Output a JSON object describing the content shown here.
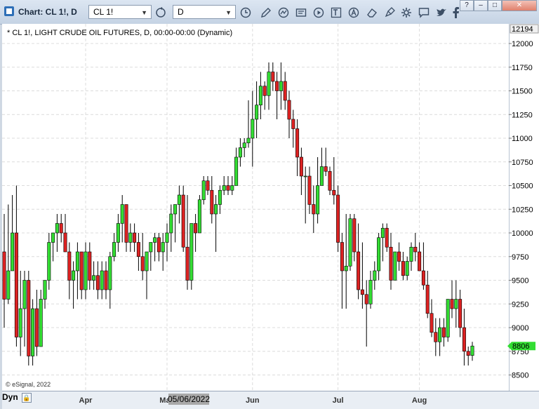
{
  "window": {
    "title": "Chart: CL 1!, D",
    "symbol_combo": "CL 1!",
    "interval_combo": "D",
    "controls": [
      "?",
      "–",
      "□",
      "✕"
    ]
  },
  "toolbar": {
    "icons": [
      "refresh-icon",
      "clock-icon",
      "pencil-icon",
      "line-tool-icon",
      "data-window-icon",
      "play-icon",
      "text-tool-icon",
      "annotation-icon",
      "eraser-icon",
      "settings-icon",
      "chat-icon",
      "twitter-icon",
      "facebook-icon"
    ]
  },
  "chart_header": "* CL 1!, LIGHT CRUDE OIL FUTURES, D, 00:00-00:00 (Dynamic)",
  "copyright": "© eSignal, 2022",
  "status": {
    "mode_label": "Dyn",
    "lock_icon": "lock-icon"
  },
  "price_axis": {
    "top_label": "12194",
    "last_price_label": "8806",
    "last_price_color": "#33dd33"
  },
  "date_axis": {
    "cursor_date": "05/06/2022"
  },
  "colors": {
    "up": "#33dd33",
    "down": "#dd2222",
    "grid": "#dcdcdc"
  },
  "chart_data": {
    "type": "candlestick",
    "ylim": [
      8400,
      12200
    ],
    "y_ticks": [
      8500,
      8750,
      9000,
      9250,
      9500,
      9750,
      10000,
      10250,
      10500,
      10750,
      11000,
      11250,
      11500,
      11750,
      12000
    ],
    "x_labels": [
      {
        "label": "Apr",
        "index": 20
      },
      {
        "label": "May",
        "index": 40
      },
      {
        "label": "Jun",
        "index": 61
      },
      {
        "label": "Jul",
        "index": 82
      },
      {
        "label": "Aug",
        "index": 102
      }
    ],
    "candles": [
      [
        9800,
        10200,
        9000,
        9300
      ],
      [
        9300,
        10300,
        9250,
        9600
      ],
      [
        9600,
        10400,
        9600,
        10000
      ],
      [
        10000,
        10500,
        8800,
        8900
      ],
      [
        8900,
        9600,
        8700,
        9200
      ],
      [
        9200,
        9600,
        8800,
        9500
      ],
      [
        9500,
        9600,
        8600,
        8700
      ],
      [
        8700,
        9300,
        8600,
        9200
      ],
      [
        9200,
        9400,
        8700,
        8800
      ],
      [
        8800,
        9400,
        8800,
        9300
      ],
      [
        9300,
        9500,
        9200,
        9500
      ],
      [
        9500,
        10000,
        9400,
        9900
      ],
      [
        9900,
        10000,
        9700,
        10000
      ],
      [
        10000,
        10200,
        9800,
        10100
      ],
      [
        10100,
        10200,
        9900,
        10000
      ],
      [
        10000,
        10200,
        9900,
        9800
      ],
      [
        9800,
        9900,
        9300,
        9500
      ],
      [
        9500,
        9700,
        9200,
        9600
      ],
      [
        9600,
        9900,
        9300,
        9800
      ],
      [
        9800,
        9800,
        9300,
        9400
      ],
      [
        9400,
        9900,
        9300,
        9800
      ],
      [
        9800,
        9900,
        9400,
        9500
      ],
      [
        9500,
        9700,
        9400,
        9550
      ],
      [
        9550,
        9700,
        9300,
        9400
      ],
      [
        9400,
        9700,
        9300,
        9600
      ],
      [
        9600,
        9700,
        9300,
        9400
      ],
      [
        9400,
        9800,
        9200,
        9750
      ],
      [
        9750,
        10000,
        9700,
        9900
      ],
      [
        9900,
        10200,
        9800,
        10100
      ],
      [
        10100,
        10400,
        9900,
        10300
      ],
      [
        10300,
        10300,
        9800,
        9900
      ],
      [
        9900,
        10100,
        9800,
        10000
      ],
      [
        10000,
        10100,
        9800,
        9900
      ],
      [
        9900,
        10000,
        9600,
        9750
      ],
      [
        9750,
        10000,
        9500,
        9600
      ],
      [
        9600,
        9800,
        9300,
        9800
      ],
      [
        9800,
        9900,
        9600,
        9900
      ],
      [
        9900,
        10000,
        9700,
        9950
      ],
      [
        9950,
        10000,
        9700,
        9800
      ],
      [
        9800,
        10000,
        9600,
        9900
      ],
      [
        9900,
        10100,
        9700,
        10000
      ],
      [
        10000,
        10300,
        9800,
        10200
      ],
      [
        10200,
        10300,
        9900,
        10300
      ],
      [
        10300,
        10500,
        10100,
        10400
      ],
      [
        10400,
        10500,
        9800,
        9850
      ],
      [
        9850,
        10400,
        9400,
        9500
      ],
      [
        9500,
        10100,
        9400,
        10100
      ],
      [
        10100,
        10200,
        9800,
        10000
      ],
      [
        10000,
        10400,
        10000,
        10350
      ],
      [
        10350,
        10600,
        10300,
        10550
      ],
      [
        10550,
        10600,
        10400,
        10450
      ],
      [
        10450,
        10600,
        10100,
        10200
      ],
      [
        10200,
        10400,
        9800,
        10300
      ],
      [
        10300,
        10500,
        10200,
        10450
      ],
      [
        10450,
        10600,
        10400,
        10500
      ],
      [
        10500,
        10600,
        10400,
        10450
      ],
      [
        10450,
        10600,
        10400,
        10500
      ],
      [
        10500,
        10900,
        10500,
        10800
      ],
      [
        10800,
        11000,
        10700,
        10900
      ],
      [
        10900,
        11000,
        10800,
        10950
      ],
      [
        10950,
        11400,
        10900,
        11000
      ],
      [
        11000,
        11500,
        10700,
        11200
      ],
      [
        11200,
        11600,
        11000,
        11350
      ],
      [
        11350,
        11700,
        11200,
        11550
      ],
      [
        11550,
        11600,
        11300,
        11450
      ],
      [
        11450,
        11800,
        11300,
        11700
      ],
      [
        11700,
        11800,
        11500,
        11600
      ],
      [
        11600,
        11700,
        11200,
        11500
      ],
      [
        11500,
        11800,
        11300,
        11600
      ],
      [
        11600,
        11700,
        11300,
        11400
      ],
      [
        11400,
        11500,
        11000,
        11200
      ],
      [
        11200,
        11300,
        10900,
        11100
      ],
      [
        11100,
        11200,
        10600,
        10800
      ],
      [
        10800,
        10900,
        10400,
        10600
      ],
      [
        10600,
        10700,
        10100,
        10600
      ],
      [
        10600,
        10700,
        10200,
        10300
      ],
      [
        10300,
        10500,
        10000,
        10200
      ],
      [
        10200,
        10800,
        10100,
        10500
      ],
      [
        10500,
        10900,
        10500,
        10700
      ],
      [
        10700,
        10900,
        10600,
        10650
      ],
      [
        10650,
        10700,
        10400,
        10450
      ],
      [
        10450,
        10800,
        10300,
        10400
      ],
      [
        10400,
        10500,
        9800,
        9900
      ],
      [
        9900,
        10000,
        9200,
        9600
      ],
      [
        9600,
        10200,
        9200,
        9650
      ],
      [
        9650,
        10200,
        9600,
        10150
      ],
      [
        10150,
        10200,
        9700,
        9800
      ],
      [
        9800,
        10100,
        9300,
        9400
      ],
      [
        9400,
        9900,
        9200,
        9350
      ],
      [
        9350,
        9500,
        8800,
        9250
      ],
      [
        9250,
        9600,
        9200,
        9500
      ],
      [
        9500,
        9700,
        9400,
        9600
      ],
      [
        9600,
        10000,
        9500,
        9950
      ],
      [
        9950,
        10100,
        9700,
        10050
      ],
      [
        10050,
        10100,
        9800,
        9850
      ],
      [
        9850,
        10000,
        9400,
        9500
      ],
      [
        9500,
        9800,
        9500,
        9800
      ],
      [
        9800,
        9900,
        9600,
        9700
      ],
      [
        9700,
        9800,
        9500,
        9550
      ],
      [
        9550,
        9750,
        9500,
        9700
      ],
      [
        9700,
        9900,
        9600,
        9850
      ],
      [
        9850,
        10000,
        9700,
        9800
      ],
      [
        9800,
        9900,
        9600,
        9600
      ],
      [
        9600,
        9900,
        9400,
        9450
      ],
      [
        9450,
        9600,
        9100,
        9150
      ],
      [
        9150,
        9300,
        8900,
        8950
      ],
      [
        8950,
        9100,
        8700,
        8850
      ],
      [
        8850,
        9100,
        8700,
        9000
      ],
      [
        9000,
        9100,
        8800,
        8900
      ],
      [
        8900,
        9300,
        8850,
        9300
      ],
      [
        9300,
        9500,
        9100,
        9200
      ],
      [
        9200,
        9500,
        9000,
        9300
      ],
      [
        9300,
        9400,
        8900,
        9000
      ],
      [
        9000,
        9200,
        8600,
        8750
      ],
      [
        8750,
        8800,
        8600,
        8706
      ],
      [
        8706,
        8850,
        8650,
        8806
      ]
    ]
  }
}
